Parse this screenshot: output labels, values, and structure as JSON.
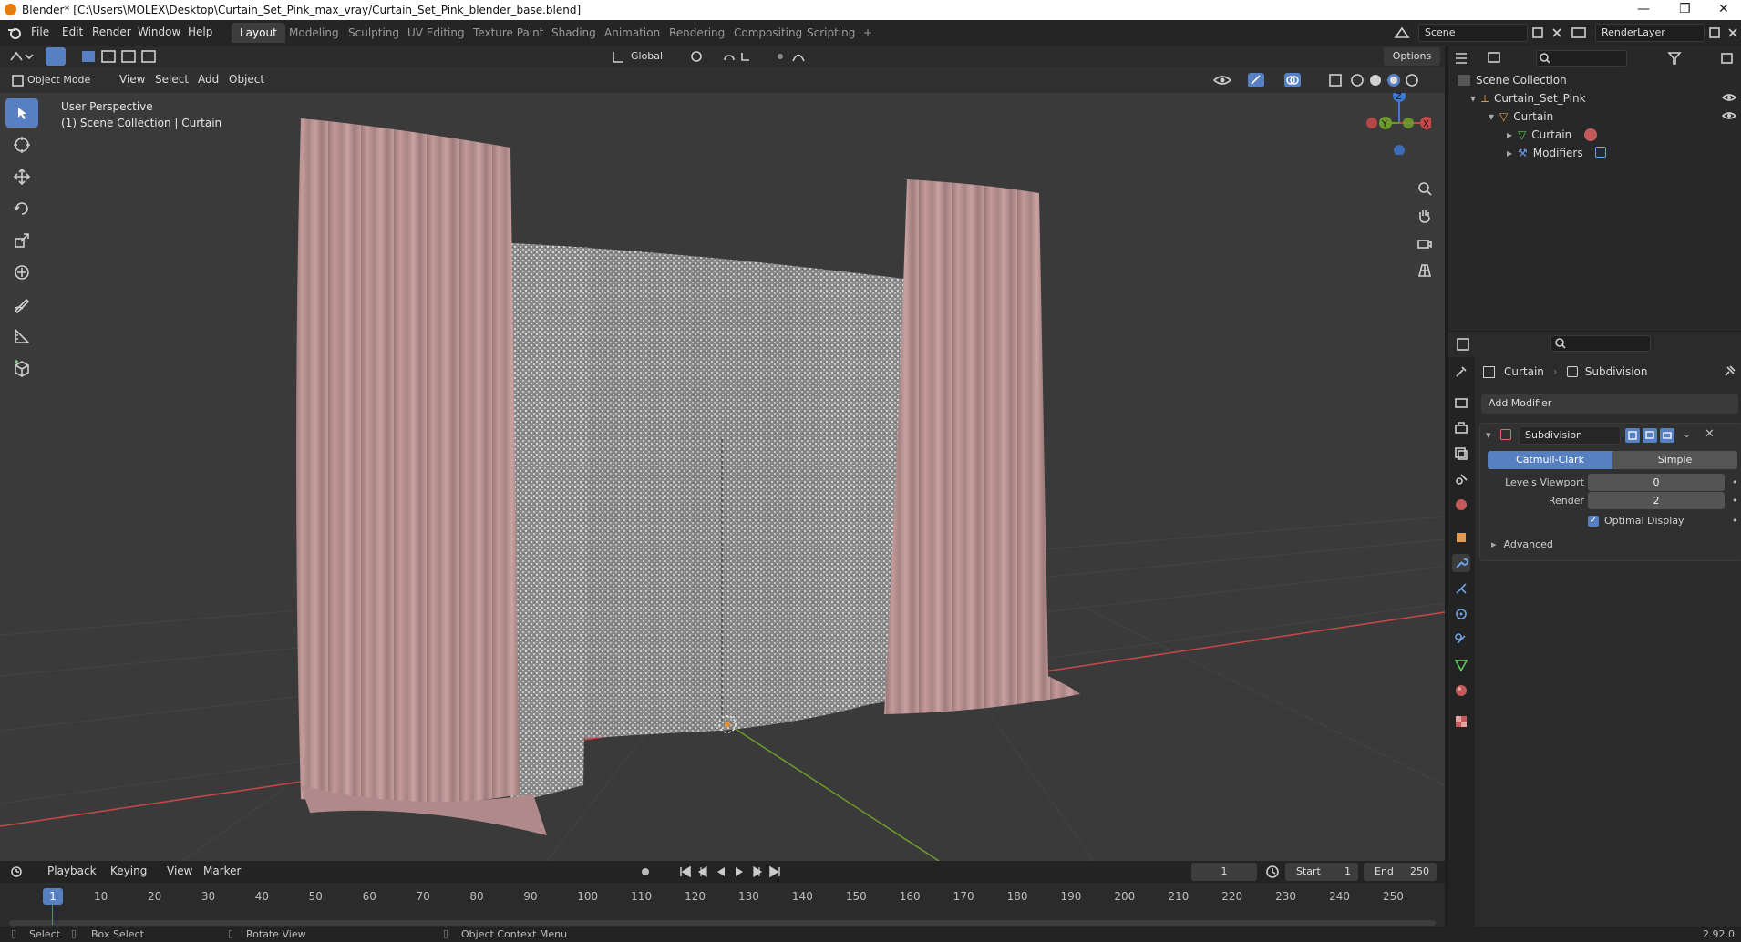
{
  "window": {
    "title": "Blender* [C:\\Users\\MOLEX\\Desktop\\Curtain_Set_Pink_max_vray/Curtain_Set_Pink_blender_base.blend]",
    "controls": [
      "—",
      "❒",
      "✕"
    ]
  },
  "menu": [
    "File",
    "Edit",
    "Render",
    "Window",
    "Help"
  ],
  "workspaces": [
    "Layout",
    "Modeling",
    "Sculpting",
    "UV Editing",
    "Texture Paint",
    "Shading",
    "Animation",
    "Rendering",
    "Compositing",
    "Scripting",
    "+"
  ],
  "active_workspace": "Layout",
  "scene": {
    "name": "Scene",
    "render_layer": "RenderLayer"
  },
  "viewport_header": {
    "transform_orientation": "Global",
    "options_label": "Options",
    "mode": "Object Mode",
    "menus": [
      "View",
      "Select",
      "Add",
      "Object"
    ]
  },
  "viewport": {
    "perspective_label": "User Perspective",
    "collection_label": "(1) Scene Collection | Curtain",
    "gizmo_axes": {
      "x": "X",
      "y": "Y",
      "z": "Z"
    }
  },
  "outliner": {
    "items": [
      {
        "label": "Scene Collection",
        "depth": 0
      },
      {
        "label": "Curtain_Set_Pink",
        "depth": 1
      },
      {
        "label": "Curtain",
        "depth": 2
      },
      {
        "label": "Curtain",
        "depth": 3
      },
      {
        "label": "Modifiers",
        "depth": 3
      }
    ]
  },
  "properties": {
    "breadcrumb_object": "Curtain",
    "breadcrumb_modifier": "Subdivision",
    "add_modifier_label": "Add Modifier",
    "modifier": {
      "name": "Subdivision",
      "types": [
        "Catmull-Clark",
        "Simple"
      ],
      "active_type": "Catmull-Clark",
      "levels_viewport_label": "Levels Viewport",
      "levels_viewport_value": "0",
      "render_label": "Render",
      "render_value": "2",
      "optimal_display_label": "Optimal Display",
      "optimal_display_checked": true,
      "advanced_label": "Advanced"
    }
  },
  "timeline": {
    "menus": [
      "Playback",
      "Keying",
      "View",
      "Marker"
    ],
    "current_frame": "1",
    "start_label": "Start",
    "start_value": "1",
    "end_label": "End",
    "end_value": "250",
    "ticks": [
      "1",
      "10",
      "20",
      "30",
      "40",
      "50",
      "60",
      "70",
      "80",
      "90",
      "100",
      "110",
      "120",
      "130",
      "140",
      "150",
      "160",
      "170",
      "180",
      "190",
      "200",
      "210",
      "220",
      "230",
      "240",
      "250"
    ]
  },
  "statusbar": {
    "items": [
      "Select",
      "Box Select",
      "Rotate View",
      "Object Context Menu"
    ],
    "version": "2.92.0"
  },
  "colors": {
    "accent": "#5680c2",
    "curtain_pink": "#b89090",
    "sheer": "#c8c8c8",
    "axis_x": "#c84848",
    "axis_y": "#6f9a2c",
    "axis_z": "#3d7bd9"
  }
}
